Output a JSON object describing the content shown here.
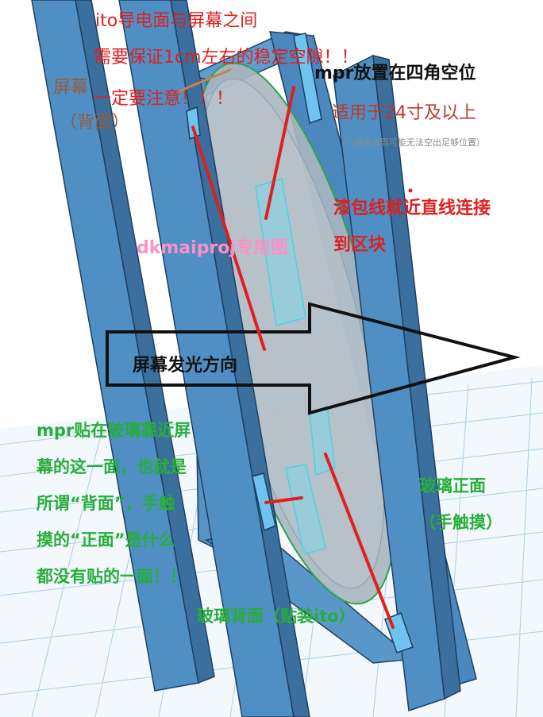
{
  "labels": {
    "ito_gap_line1": "ito导电面与屏幕之间",
    "ito_gap_line2": "需要保证1cm左右的稳定空隙！！",
    "ito_gap_line3": "一定要注意！！！",
    "screen_back_line1": "屏幕",
    "screen_back_line2": "（背面）",
    "mpr_corner": "mpr放置在四角空位",
    "size_note": "适用于24寸及以上",
    "small_screen_note": "（小屏幕四周可能无法空出足够位置）",
    "wire_line1": "漆包线就近直线连接",
    "wire_line2": "到区块",
    "watermark": "dkmaiproj专用图",
    "light_direction": "屏幕发光方向",
    "mpr_glass_line1": "mpr贴在玻璃靠近屏",
    "mpr_glass_line2": "幕的这一面，也就是",
    "mpr_glass_line3": "所谓“背面”，手触",
    "mpr_glass_line4": "摸的“正面”是什么",
    "mpr_glass_line5": "都没有贴的一面！！",
    "glass_front_line1": "玻璃正面",
    "glass_front_line2": "（手触摸）",
    "glass_back": "玻璃背面（贴装ito）"
  },
  "colors": {
    "frame": "#4f8fc4",
    "frame_edge": "#1f3f5f",
    "glass": "#a8b4bc",
    "ito": "#7fd6e6",
    "annotation_line": "#e02020",
    "grid": "#9ec8e8"
  }
}
